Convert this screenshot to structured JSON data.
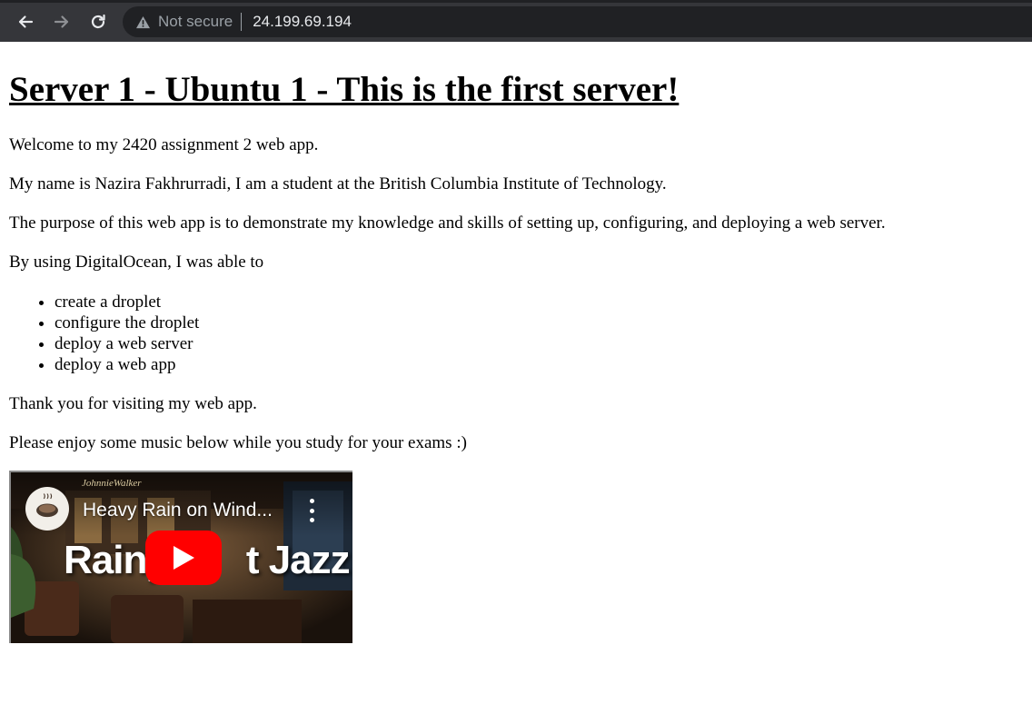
{
  "browser": {
    "security_label": "Not secure",
    "url": "24.199.69.194"
  },
  "page": {
    "heading": "Server 1 - Ubuntu 1 - This is the first server!",
    "welcome": "Welcome to my 2420 assignment 2 web app.",
    "intro": "My name is Nazira Fakhrurradi, I am a student at the British Columbia Institute of Technology.",
    "purpose": "The purpose of this web app is to demonstrate my knowledge and skills of setting up, configuring, and deploying a web server.",
    "list_intro": "By using DigitalOcean, I was able to",
    "list_items": [
      "create a droplet",
      "configure the droplet",
      "deploy a web server",
      "deploy a web app"
    ],
    "thanks": "Thank you for visiting my web app.",
    "music_note": "Please enjoy some music below while you study for your exams :)"
  },
  "video": {
    "title": "Heavy Rain on Wind...",
    "thumbnail_left": "Rainy",
    "thumbnail_right": "t Jazz",
    "brand_sign": "JohnnieWalker",
    "play_color": "#ff0000"
  }
}
